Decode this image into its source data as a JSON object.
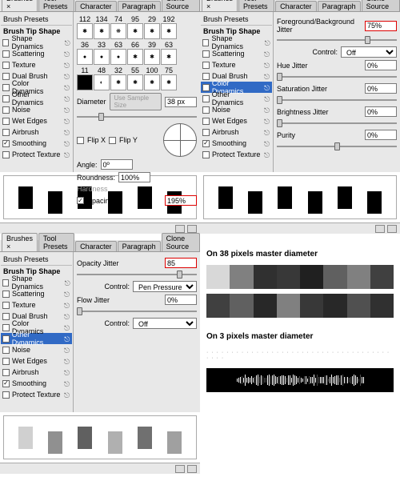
{
  "tabs": [
    "Brushes",
    "Tool Presets",
    "Character",
    "Paragraph",
    "Clone Source"
  ],
  "tab_close": "×",
  "side_header": "Brush Presets",
  "side_tip": "Brush Tip Shape",
  "side_items": [
    {
      "label": "Shape Dynamics",
      "chk": false,
      "lock": true
    },
    {
      "label": "Scattering",
      "chk": false,
      "lock": true
    },
    {
      "label": "Texture",
      "chk": false,
      "lock": true
    },
    {
      "label": "Dual Brush",
      "chk": false,
      "lock": true
    },
    {
      "label": "Color Dynamics",
      "chk": false,
      "lock": true
    },
    {
      "label": "Other Dynamics",
      "chk": false,
      "lock": true
    },
    {
      "label": "Noise",
      "chk": false,
      "lock": true
    },
    {
      "label": "Wet Edges",
      "chk": false,
      "lock": true
    },
    {
      "label": "Airbrush",
      "chk": false,
      "lock": true
    },
    {
      "label": "Smoothing",
      "chk": true,
      "lock": true
    },
    {
      "label": "Protect Texture",
      "chk": false,
      "lock": true
    }
  ],
  "q1": {
    "swatch_nums_top": [
      "112",
      "134",
      "74",
      "95",
      "29",
      "192"
    ],
    "swatch_nums_mid": [
      "36",
      "33",
      "63",
      "66",
      "39",
      "63"
    ],
    "swatch_nums_bot": [
      "11",
      "48",
      "32",
      "55",
      "100",
      "75"
    ],
    "diameter_label": "Diameter",
    "diameter_btn": "Use Sample Size",
    "diameter_val": "38 px",
    "flipx": "Flip X",
    "flipy": "Flip Y",
    "angle_label": "Angle:",
    "angle_val": "0º",
    "round_label": "Roundness:",
    "round_val": "100%",
    "hard_label": "Hardness",
    "spacing_label": "Spacing",
    "spacing_val": "195%"
  },
  "q2": {
    "fg_label": "Foreground/Background Jitter",
    "fg_val": "75%",
    "control_label": "Control:",
    "control_val": "Off",
    "hue_label": "Hue Jitter",
    "hue_val": "0%",
    "sat_label": "Saturation Jitter",
    "sat_val": "0%",
    "bri_label": "Brightness Jitter",
    "bri_val": "0%",
    "pur_label": "Purity",
    "pur_val": "0%",
    "sel_idx": 4
  },
  "q3": {
    "op_label": "Opacity Jitter",
    "op_val": "85",
    "control_label": "Control:",
    "control1": "Pen Pressure",
    "control2": "Off",
    "flow_label": "Flow Jitter",
    "flow_val": "0%",
    "sel_idx": 5,
    "grays": [
      "#d0d0d0",
      "#909090",
      "#606060",
      "#b0b0b0",
      "#707070",
      "#a0a0a0"
    ]
  },
  "q4": {
    "title1": "On 38 pixels master diameter",
    "title2": "On 3 pixels master diameter",
    "light": [
      "#d8d8d8",
      "#808080",
      "#303030",
      "#383838",
      "#202020",
      "#606060",
      "#808080",
      "#404040"
    ],
    "dark": [
      "#404040",
      "#606060",
      "#282828",
      "#808080",
      "#383838",
      "#282828",
      "#505050",
      "#303030"
    ]
  }
}
